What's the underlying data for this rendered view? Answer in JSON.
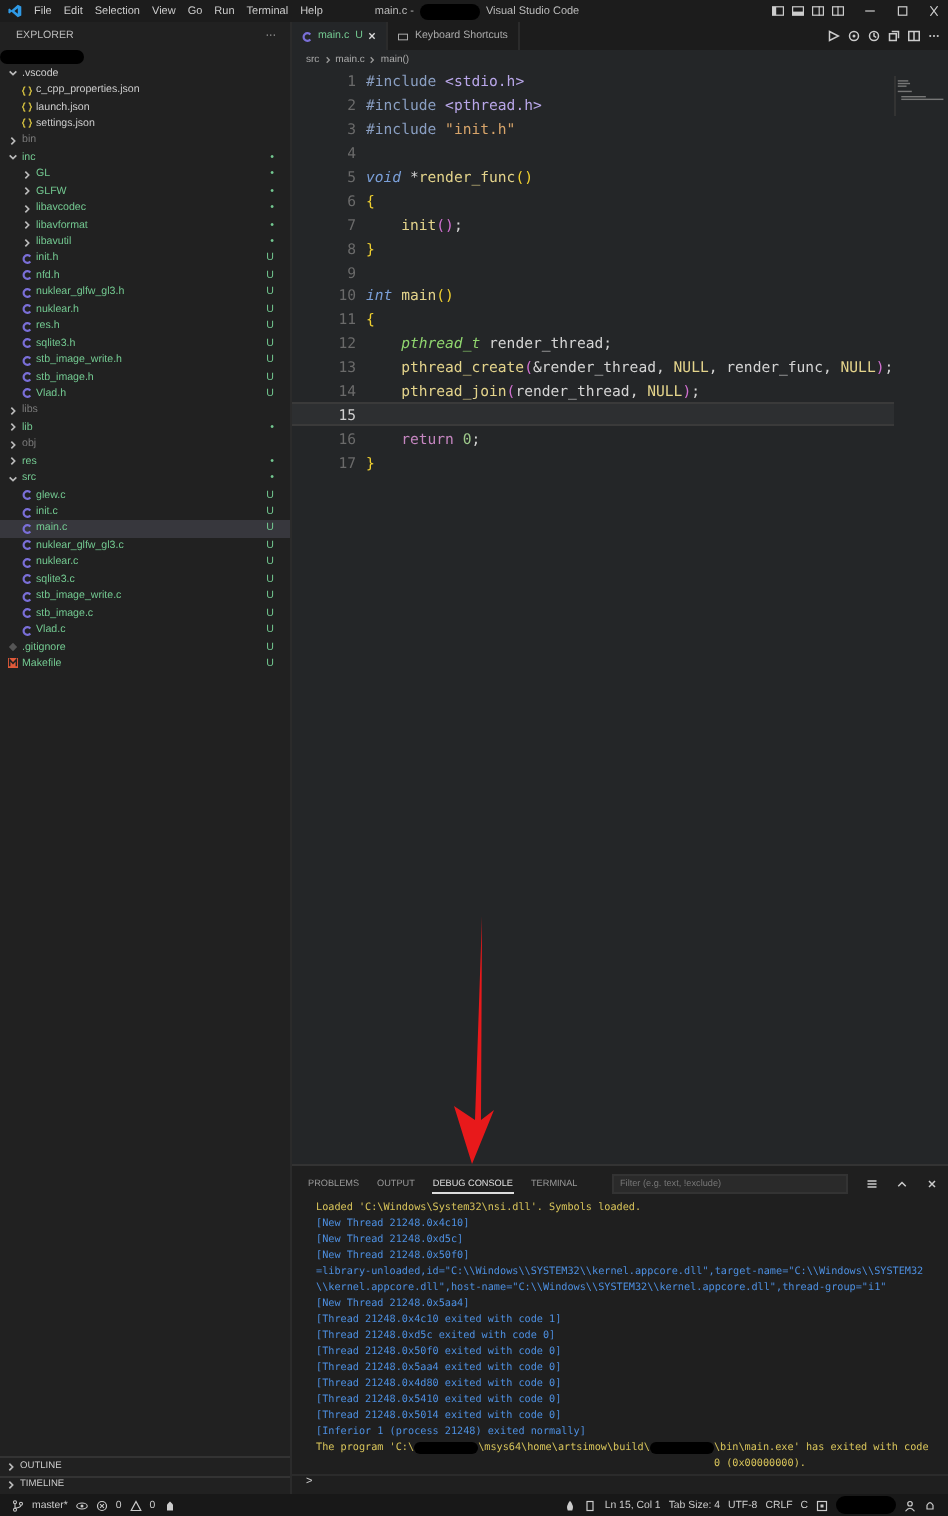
{
  "menu": [
    "File",
    "Edit",
    "Selection",
    "View",
    "Go",
    "Run",
    "Terminal",
    "Help"
  ],
  "window": {
    "title_start": "main.c -",
    "title_end": "Visual Studio Code"
  },
  "explorer": {
    "title": "EXPLORER",
    "more": "···",
    "items": [
      {
        "name": ".vscode",
        "kind": "folder",
        "expanded": true,
        "untracked": false,
        "ignored": false,
        "selected": false,
        "children": [
          {
            "name": "c_cpp_properties.json",
            "kind": "json",
            "untracked": false,
            "ignored": false,
            "selected": false
          },
          {
            "name": "launch.json",
            "kind": "json",
            "untracked": false,
            "ignored": false,
            "selected": false
          },
          {
            "name": "settings.json",
            "kind": "json",
            "untracked": false,
            "ignored": false,
            "selected": false
          }
        ]
      },
      {
        "name": "bin",
        "kind": "folder",
        "expanded": false,
        "untracked": false,
        "ignored": true,
        "selected": false
      },
      {
        "name": "inc",
        "kind": "folder",
        "expanded": true,
        "untracked": true,
        "ignored": false,
        "badge": "•",
        "selected": false,
        "children": [
          {
            "name": "GL",
            "kind": "folder",
            "expanded": false,
            "untracked": true,
            "ignored": false,
            "badge": "•",
            "selected": false
          },
          {
            "name": "GLFW",
            "kind": "folder",
            "expanded": false,
            "untracked": true,
            "ignored": false,
            "badge": "•",
            "selected": false
          },
          {
            "name": "libavcodec",
            "kind": "folder",
            "expanded": false,
            "untracked": true,
            "ignored": false,
            "badge": "•",
            "selected": false
          },
          {
            "name": "libavformat",
            "kind": "folder",
            "expanded": false,
            "untracked": true,
            "ignored": false,
            "badge": "•",
            "selected": false
          },
          {
            "name": "libavutil",
            "kind": "folder",
            "expanded": false,
            "untracked": true,
            "ignored": false,
            "badge": "•",
            "selected": false
          },
          {
            "name": "init.h",
            "kind": "c",
            "untracked": true,
            "ignored": false,
            "badge": "U",
            "selected": false
          },
          {
            "name": "nfd.h",
            "kind": "c",
            "untracked": true,
            "ignored": false,
            "badge": "U",
            "selected": false
          },
          {
            "name": "nuklear_glfw_gl3.h",
            "kind": "c",
            "untracked": true,
            "ignored": false,
            "badge": "U",
            "selected": false
          },
          {
            "name": "nuklear.h",
            "kind": "c",
            "untracked": true,
            "ignored": false,
            "badge": "U",
            "selected": false
          },
          {
            "name": "res.h",
            "kind": "c",
            "untracked": true,
            "ignored": false,
            "badge": "U",
            "selected": false
          },
          {
            "name": "sqlite3.h",
            "kind": "c",
            "untracked": true,
            "ignored": false,
            "badge": "U",
            "selected": false
          },
          {
            "name": "stb_image_write.h",
            "kind": "c",
            "untracked": true,
            "ignored": false,
            "badge": "U",
            "selected": false
          },
          {
            "name": "stb_image.h",
            "kind": "c",
            "untracked": true,
            "ignored": false,
            "badge": "U",
            "selected": false
          },
          {
            "name": "Vlad.h",
            "kind": "c",
            "untracked": true,
            "ignored": false,
            "badge": "U",
            "selected": false
          }
        ]
      },
      {
        "name": "libs",
        "kind": "folder",
        "expanded": false,
        "untracked": false,
        "ignored": true,
        "selected": false
      },
      {
        "name": "lib",
        "kind": "folder",
        "expanded": false,
        "untracked": true,
        "ignored": false,
        "badge": "•",
        "selected": false
      },
      {
        "name": "obj",
        "kind": "folder",
        "expanded": false,
        "untracked": false,
        "ignored": true,
        "selected": false
      },
      {
        "name": "res",
        "kind": "folder",
        "expanded": false,
        "untracked": true,
        "ignored": false,
        "badge": "•",
        "selected": false
      },
      {
        "name": "src",
        "kind": "folder",
        "expanded": true,
        "untracked": true,
        "ignored": false,
        "badge": "•",
        "selected": false,
        "children": [
          {
            "name": "glew.c",
            "kind": "c",
            "untracked": true,
            "ignored": false,
            "badge": "U",
            "selected": false
          },
          {
            "name": "init.c",
            "kind": "c",
            "untracked": true,
            "ignored": false,
            "badge": "U",
            "selected": false
          },
          {
            "name": "main.c",
            "kind": "c",
            "untracked": true,
            "ignored": false,
            "badge": "U",
            "selected": true
          },
          {
            "name": "nuklear_glfw_gl3.c",
            "kind": "c",
            "untracked": true,
            "ignored": false,
            "badge": "U",
            "selected": false
          },
          {
            "name": "nuklear.c",
            "kind": "c",
            "untracked": true,
            "ignored": false,
            "badge": "U",
            "selected": false
          },
          {
            "name": "sqlite3.c",
            "kind": "c",
            "untracked": true,
            "ignored": false,
            "badge": "U",
            "selected": false
          },
          {
            "name": "stb_image_write.c",
            "kind": "c",
            "untracked": true,
            "ignored": false,
            "badge": "U",
            "selected": false
          },
          {
            "name": "stb_image.c",
            "kind": "c",
            "untracked": true,
            "ignored": false,
            "badge": "U",
            "selected": false
          },
          {
            "name": "Vlad.c",
            "kind": "c",
            "untracked": true,
            "ignored": false,
            "badge": "U",
            "selected": false
          }
        ]
      },
      {
        "name": ".gitignore",
        "kind": "git",
        "untracked": true,
        "ignored": false,
        "badge": "U",
        "selected": false
      },
      {
        "name": "Makefile",
        "kind": "make",
        "untracked": true,
        "ignored": false,
        "badge": "U",
        "selected": false
      }
    ]
  },
  "sections": [
    {
      "label": "OUTLINE",
      "expanded": false
    },
    {
      "label": "TIMELINE",
      "expanded": false
    }
  ],
  "editor_tabs": [
    {
      "label": "main.c",
      "badge": "U",
      "kind": "c",
      "selected": true
    },
    {
      "label": "Keyboard Shortcuts",
      "kind": "keyboard",
      "selected": false
    }
  ],
  "breadcrumb": [
    "src",
    "main.c",
    "main()"
  ],
  "code": [
    {
      "number": "1",
      "current": false,
      "tokens": [
        {
          "text": "#include ",
          "kind": "directive"
        },
        {
          "text": "<stdio.h>",
          "kind": "header"
        }
      ]
    },
    {
      "number": "2",
      "current": false,
      "tokens": [
        {
          "text": "#include ",
          "kind": "directive"
        },
        {
          "text": "<pthread.h>",
          "kind": "header"
        }
      ]
    },
    {
      "number": "3",
      "current": false,
      "tokens": [
        {
          "text": "#include ",
          "kind": "directive"
        },
        {
          "text": "\"init.h\"",
          "kind": "string"
        }
      ]
    },
    {
      "number": "4",
      "current": false
    },
    {
      "number": "5",
      "current": false,
      "tokens": [
        {
          "text": "void ",
          "kind": "keyword"
        },
        {
          "text": "*"
        },
        {
          "text": "render_func",
          "kind": "function"
        },
        {
          "text": "()",
          "kind": "bracket1"
        }
      ]
    },
    {
      "number": "6",
      "current": false,
      "tokens": [
        {
          "text": "{",
          "kind": "bracket1"
        }
      ]
    },
    {
      "number": "7",
      "current": false,
      "tokens": [
        {
          "text": "    init",
          "kind": "function"
        },
        {
          "text": "()",
          "kind": "bracket2"
        },
        {
          "text": ";"
        }
      ]
    },
    {
      "number": "8",
      "current": false,
      "tokens": [
        {
          "text": "}",
          "kind": "bracket1"
        }
      ]
    },
    {
      "number": "9",
      "current": false
    },
    {
      "number": "10",
      "current": false,
      "tokens": [
        {
          "text": "int ",
          "kind": "keyword"
        },
        {
          "text": "main",
          "kind": "function"
        },
        {
          "text": "()",
          "kind": "bracket1"
        }
      ]
    },
    {
      "number": "11",
      "current": false,
      "tokens": [
        {
          "text": "{",
          "kind": "bracket1"
        }
      ]
    },
    {
      "number": "12",
      "current": false,
      "tokens": [
        {
          "text": "    pthread_t",
          "kind": "type"
        },
        {
          "text": " render_thread;"
        }
      ]
    },
    {
      "number": "13",
      "current": false,
      "tokens": [
        {
          "text": "    pthread_create",
          "kind": "function"
        },
        {
          "text": "(",
          "kind": "bracket2"
        },
        {
          "text": "&render_thread, "
        },
        {
          "text": "NULL",
          "kind": "macro"
        },
        {
          "text": ", render_func, "
        },
        {
          "text": "NULL",
          "kind": "macro"
        },
        {
          "text": ")",
          "kind": "bracket2"
        },
        {
          "text": ";"
        }
      ]
    },
    {
      "number": "14",
      "current": false,
      "tokens": [
        {
          "text": "    pthread_join",
          "kind": "function"
        },
        {
          "text": "(",
          "kind": "bracket2"
        },
        {
          "text": "render_thread, "
        },
        {
          "text": "NULL",
          "kind": "macro"
        },
        {
          "text": ")",
          "kind": "bracket2"
        },
        {
          "text": ";"
        }
      ]
    },
    {
      "number": "15",
      "current": true
    },
    {
      "number": "16",
      "current": false,
      "tokens": [
        {
          "text": "    return ",
          "kind": "keyword2"
        },
        {
          "text": "0",
          "kind": "number"
        },
        {
          "text": ";"
        }
      ]
    },
    {
      "number": "17",
      "current": false,
      "tokens": [
        {
          "text": "}",
          "kind": "bracket1"
        }
      ]
    }
  ],
  "panel": {
    "tabs": [
      {
        "label": "PROBLEMS",
        "selected": false
      },
      {
        "label": "OUTPUT",
        "selected": false
      },
      {
        "label": "DEBUG CONSOLE",
        "selected": true
      },
      {
        "label": "TERMINAL",
        "selected": false
      }
    ],
    "filter": {
      "placeholder": "Filter (e.g. text, !exclude)"
    },
    "lines": [
      {
        "kind": "info",
        "text": "Loaded 'C:\\Windows\\System32\\nsi.dll'. Symbols loaded."
      },
      {
        "kind": "log",
        "text": "[New Thread 21248.0x4c10]"
      },
      {
        "kind": "log",
        "text": "[New Thread 21248.0xd5c]"
      },
      {
        "kind": "log",
        "text": "[New Thread 21248.0x50f0]"
      },
      {
        "kind": "log",
        "text": "=library-unloaded,id=\"C:\\\\Windows\\\\SYSTEM32\\\\kernel.appcore.dll\",target-name=\"C:\\\\Windows\\\\SYSTEM32\\\\kernel.appcore.dll\",host-name=\"C:\\\\Windows\\\\SYSTEM32\\\\kernel.appcore.dll\",thread-group=\"i1\""
      },
      {
        "kind": "log",
        "text": "[New Thread 21248.0x5aa4]"
      },
      {
        "kind": "log",
        "text": "[Thread 21248.0x4c10 exited with code 1]"
      },
      {
        "kind": "log",
        "text": "[Thread 21248.0xd5c exited with code 0]"
      },
      {
        "kind": "log",
        "text": "[Thread 21248.0x50f0 exited with code 0]"
      },
      {
        "kind": "log",
        "text": "[Thread 21248.0x5aa4 exited with code 0]"
      },
      {
        "kind": "log",
        "text": "[Thread 21248.0x4d80 exited with code 0]"
      },
      {
        "kind": "log",
        "text": "[Thread 21248.0x5410 exited with code 0]"
      },
      {
        "kind": "log",
        "text": "[Thread 21248.0x5014 exited with code 0]"
      },
      {
        "kind": "log",
        "text": "[Inferior 1 (process 21248) exited normally]"
      },
      {
        "kind": "redacted",
        "parts": [
          "The program 'C:\\",
          "\\msys64\\home\\artsimow\\build\\",
          "\\bin\\main.exe' has exited with code 0 (0x00000000)."
        ]
      }
    ],
    "prompt": ">"
  },
  "status_bar": {
    "branch": "master*",
    "errors": "0",
    "warnings": "0",
    "right": [
      "Ln 15, Col 1",
      "Tab Size: 4",
      "UTF-8",
      "CRLF",
      "C"
    ]
  }
}
